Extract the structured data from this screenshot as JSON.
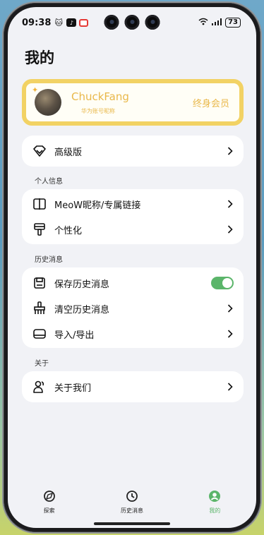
{
  "status_bar": {
    "time": "09:38",
    "battery": "73"
  },
  "page": {
    "title": "我的"
  },
  "profile": {
    "name": "ChuckFang",
    "subtitle": "华为账号昵称",
    "tier": "终身会员"
  },
  "premium": {
    "label": "高级版"
  },
  "sections": {
    "personal": {
      "label": "个人信息",
      "items": [
        {
          "label": "MeoW昵称/专属链接"
        },
        {
          "label": "个性化"
        }
      ]
    },
    "history": {
      "label": "历史消息",
      "items": [
        {
          "label": "保存历史消息",
          "toggle_on": true
        },
        {
          "label": "清空历史消息"
        },
        {
          "label": "导入/导出"
        }
      ]
    },
    "about": {
      "label": "关于",
      "items": [
        {
          "label": "关于我们"
        }
      ]
    }
  },
  "tabbar": {
    "tabs": [
      {
        "label": "探索",
        "icon": "explore-icon",
        "active": false
      },
      {
        "label": "历史消息",
        "icon": "history-clock-icon",
        "active": false
      },
      {
        "label": "我的",
        "icon": "profile-icon",
        "active": true
      }
    ]
  },
  "colors": {
    "accent_green": "#5bb56a",
    "gold": "#e9b84a",
    "profile_border": "#f2d264"
  }
}
